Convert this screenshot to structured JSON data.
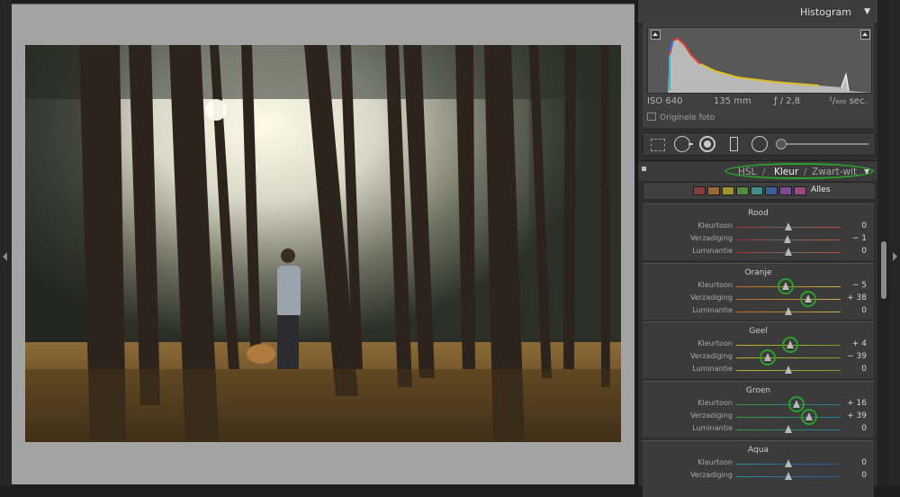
{
  "photo": {
    "description_name": "forest scene",
    "colors": {
      "sky": "#eef0ec",
      "ground": "#7a5a2e"
    }
  },
  "histogram": {
    "title": "Histogram",
    "iso": "ISO 640",
    "focal_length": "135 mm",
    "aperture": "ƒ / 2,8",
    "shutter": "¹/₈₀₀ sec.",
    "original_photo_label": "Originele foto"
  },
  "hsl": {
    "tabs": [
      "HSL",
      "Kleur",
      "Zwart-wit"
    ],
    "separator": "/",
    "active_tab": "Kleur",
    "swatch_colors": [
      "#8a3b3b",
      "#9a6a36",
      "#9e9631",
      "#4f8a3e",
      "#3f8f8a",
      "#3e5c9c",
      "#7a4b9a",
      "#9a4a7e"
    ],
    "all_label": "Alles",
    "highlight_color": "#2da02d",
    "groups": [
      {
        "name": "Rood",
        "rows": [
          {
            "label": "Kleurtoon",
            "value": "0",
            "level": 0,
            "highlighted": false
          },
          {
            "label": "Verzadiging",
            "value": "− 1",
            "level": -1,
            "highlighted": false
          },
          {
            "label": "Luminantie",
            "value": "0",
            "level": 0,
            "highlighted": false
          }
        ]
      },
      {
        "name": "Oranje",
        "rows": [
          {
            "label": "Kleurtoon",
            "value": "− 5",
            "level": -5,
            "highlighted": true
          },
          {
            "label": "Verzadiging",
            "value": "+ 38",
            "level": 38,
            "highlighted": true
          },
          {
            "label": "Luminantie",
            "value": "0",
            "level": 0,
            "highlighted": false
          }
        ]
      },
      {
        "name": "Geel",
        "rows": [
          {
            "label": "Kleurtoon",
            "value": "+ 4",
            "level": 4,
            "highlighted": true
          },
          {
            "label": "Verzadiging",
            "value": "− 39",
            "level": -39,
            "highlighted": true
          },
          {
            "label": "Luminantie",
            "value": "0",
            "level": 0,
            "highlighted": false
          }
        ]
      },
      {
        "name": "Groen",
        "rows": [
          {
            "label": "Kleurtoon",
            "value": "+ 16",
            "level": 16,
            "highlighted": true
          },
          {
            "label": "Verzadiging",
            "value": "+ 39",
            "level": 39,
            "highlighted": true
          },
          {
            "label": "Luminantie",
            "value": "0",
            "level": 0,
            "highlighted": false
          }
        ]
      },
      {
        "name": "Aqua",
        "rows": [
          {
            "label": "Kleurtoon",
            "value": "0",
            "level": 0,
            "highlighted": false
          },
          {
            "label": "Verzadiging",
            "value": "0",
            "level": 0,
            "highlighted": false
          }
        ]
      }
    ]
  }
}
